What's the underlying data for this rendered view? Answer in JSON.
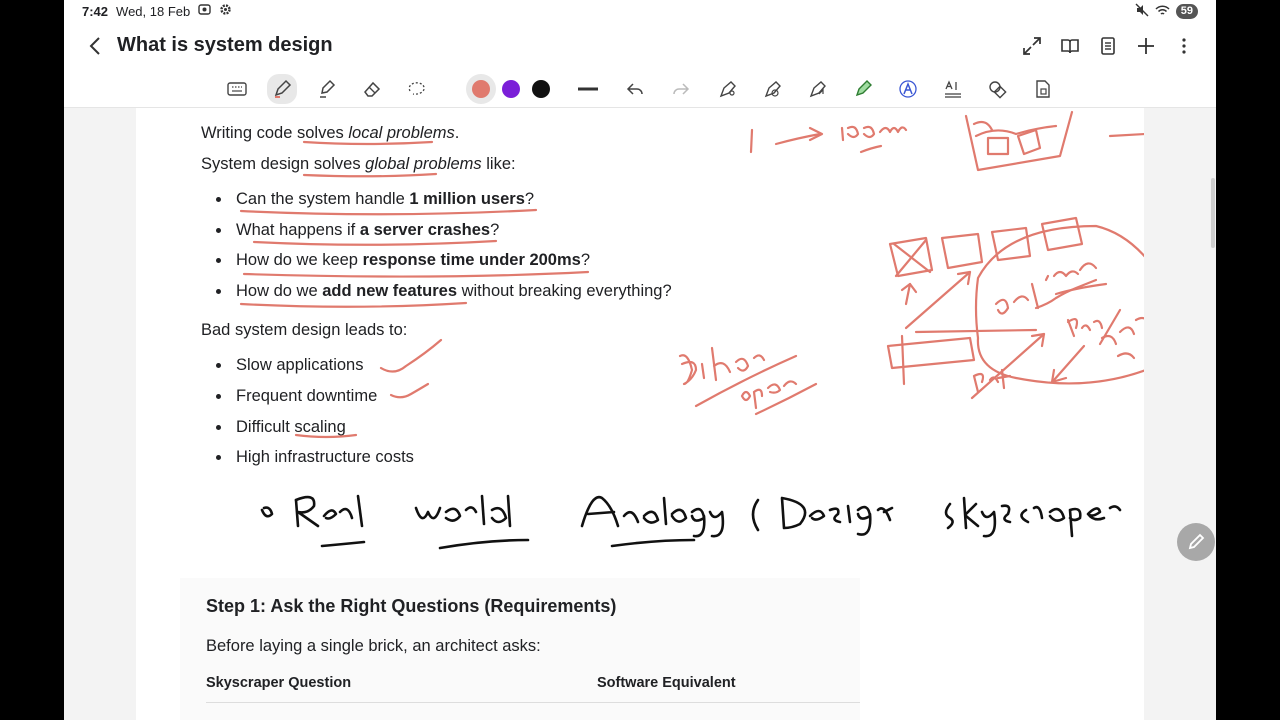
{
  "status": {
    "time": "7:42",
    "date": "Wed, 18 Feb",
    "battery": "59"
  },
  "title": "What is system design",
  "colors": {
    "pen_red": "#e07a6e",
    "pen_purple": "#7b1fd8",
    "pen_black": "#111111"
  },
  "intro": {
    "line1_a": "Writing code ",
    "line1_b": "solves ",
    "line1_c": "local problems",
    "line1_d": ".",
    "line2_a": "System design ",
    "line2_b": "solves ",
    "line2_c": "global problems",
    "line2_d": " like:"
  },
  "questions": [
    {
      "pre": "Can the system handle ",
      "bold": "1 million users",
      "post": "?"
    },
    {
      "pre": "What happens if ",
      "bold": "a server crashes",
      "post": "?"
    },
    {
      "pre": "How do we keep ",
      "bold": "response time under 200ms",
      "post": "?"
    },
    {
      "pre": "How do we ",
      "bold": "add new features",
      "post": " without breaking everything?"
    }
  ],
  "bad_heading": "Bad system design leads to:",
  "bad_items": [
    "Slow applications",
    "Frequent downtime",
    "Difficult scaling",
    "High infrastructure costs"
  ],
  "step": {
    "heading": "Step 1: Ask the Right Questions (Requirements)",
    "intro": "Before laying a single brick, an architect asks:",
    "col1": "Skyscraper Question",
    "col2": "Software Equivalent"
  }
}
